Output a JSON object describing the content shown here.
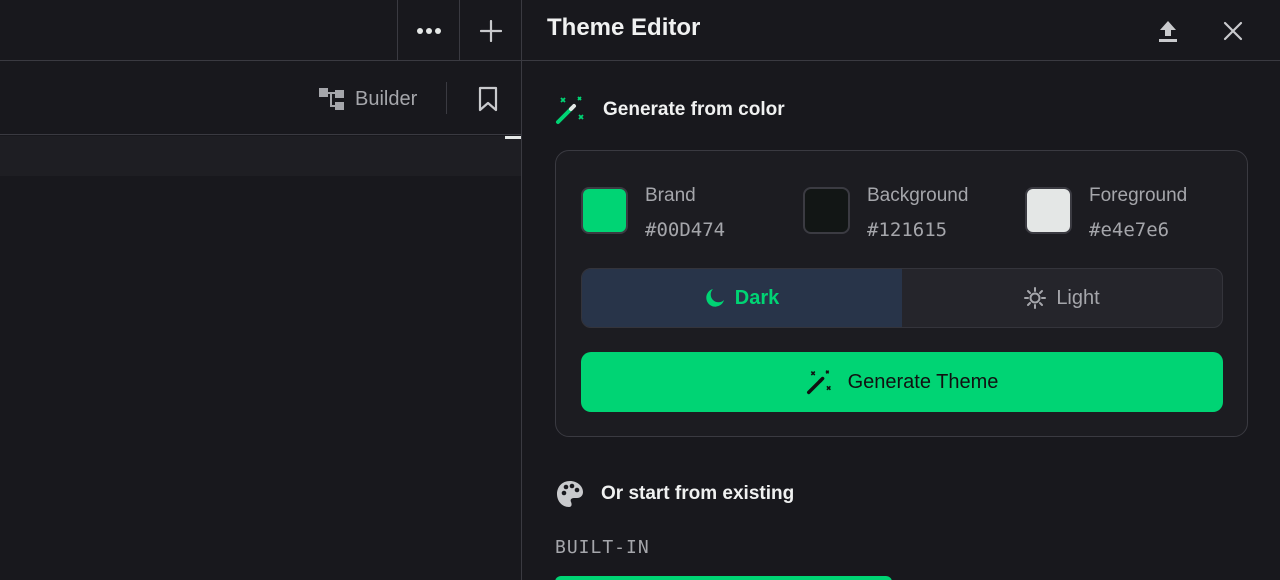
{
  "left_pane": {
    "toolbar": {
      "more_icon": "more-horizontal-icon",
      "add_icon": "plus-icon",
      "builder_label": "Builder",
      "builder_icon": "builder-tree-icon",
      "bookmark_icon": "bookmark-icon"
    }
  },
  "panel": {
    "title": "Theme Editor",
    "upload_icon": "upload-icon",
    "close_icon": "close-icon",
    "generate_section": {
      "title": "Generate from color",
      "icon": "magic-wand-icon",
      "colors": [
        {
          "label": "Brand",
          "hex": "#00D474",
          "swatch": "#00D474"
        },
        {
          "label": "Background",
          "hex": "#121615",
          "swatch": "#121615"
        },
        {
          "label": "Foreground",
          "hex": "#e4e7e6",
          "swatch": "#e4e7e6"
        }
      ],
      "modes": [
        {
          "label": "Dark",
          "icon": "moon-icon",
          "selected": true
        },
        {
          "label": "Light",
          "icon": "sun-icon",
          "selected": false
        }
      ],
      "generate_button": "Generate Theme"
    },
    "existing_section": {
      "title": "Or start from existing",
      "icon": "palette-icon",
      "builtin_label": "BUILT-IN"
    }
  },
  "colors": {
    "accent": "#00D474",
    "bg": "#18181d",
    "border": "#3a3a41",
    "muted": "#a5a6ab"
  }
}
